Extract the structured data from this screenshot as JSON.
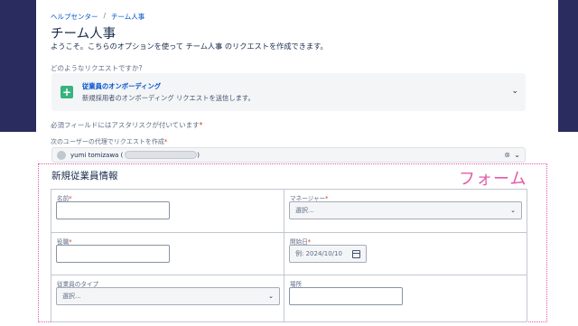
{
  "breadcrumb": {
    "home": "ヘルプセンター",
    "separator": "/",
    "current": "チーム人事"
  },
  "page": {
    "title": "チーム人事",
    "subtitle": "ようこそ。こちらのオプションを使って チーム人事 のリクエストを作成できます。"
  },
  "request_type": {
    "question": "どのようなリクエストですか?",
    "name": "従業員のオンボーディング",
    "description": "新規採用者のオンボーディング リクエストを送信します。",
    "icon": "plus-icon"
  },
  "required_note": {
    "text": "必須フィールドにはアスタリスクが付いています",
    "asterisk": "*"
  },
  "on_behalf": {
    "label": "次のユーザーの代理でリクエストを作成",
    "asterisk": "*",
    "value_prefix": "yumi tomizawa (",
    "value_suffix": ")"
  },
  "annotation": {
    "caption": "フォーム",
    "color": "#e05aa8"
  },
  "form": {
    "section_title": "新規従業員情報",
    "name_label": "名前",
    "manager_label": "マネージャー",
    "manager_placeholder": "選択...",
    "title_label": "役職",
    "start_date_label": "開始日",
    "start_date_placeholder": "例: 2024/10/10",
    "employee_type_label": "従業員のタイプ",
    "employee_type_placeholder": "選択...",
    "location_label": "場所",
    "asterisk": "*"
  },
  "colors": {
    "sidebar": "#2a2b5e",
    "link": "#0052cc",
    "required": "#de350b",
    "success": "#36b37e"
  }
}
